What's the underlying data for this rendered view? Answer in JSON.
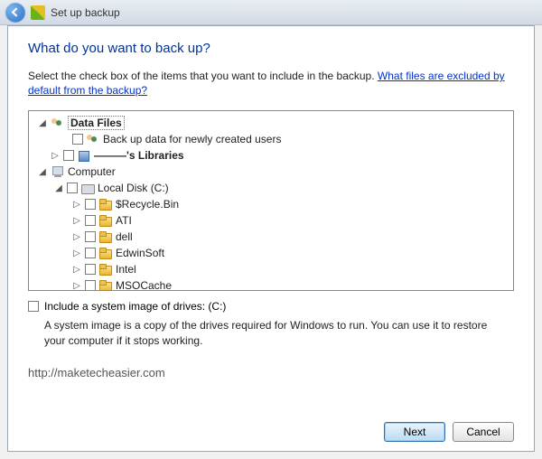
{
  "titlebar": {
    "title": "Set up backup"
  },
  "heading": "What do you want to back up?",
  "intro": {
    "text": "Select the check box of the items that you want to include in the backup. ",
    "link": "What files are excluded by default from the backup?"
  },
  "tree": {
    "root1": {
      "label": "Data Files",
      "expanded": true
    },
    "newusers": {
      "label": "Back up data for newly created users"
    },
    "userlib": {
      "name_hidden": "———'s Libraries"
    },
    "root2": {
      "label": "Computer",
      "expanded": true
    },
    "localdisk": {
      "label": "Local Disk (C:)",
      "expanded": true
    },
    "folders": [
      {
        "label": "$Recycle.Bin"
      },
      {
        "label": "ATI"
      },
      {
        "label": "dell"
      },
      {
        "label": "EdwinSoft"
      },
      {
        "label": "Intel"
      },
      {
        "label": "MSOCache"
      }
    ]
  },
  "system_image": {
    "checkbox_label": "Include a system image of drives: (C:)",
    "description": "A system image is a copy of the drives required for Windows to run. You can use it to restore your computer if it stops working."
  },
  "watermark": "http://maketecheasier.com",
  "buttons": {
    "next": "Next",
    "cancel": "Cancel"
  }
}
